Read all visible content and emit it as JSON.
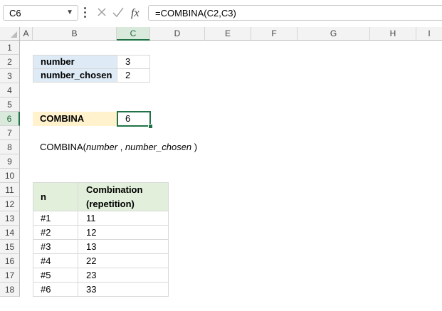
{
  "formula_bar": {
    "name_box": "C6",
    "formula": "=COMBINA(C2,C3)"
  },
  "columns": [
    "A",
    "B",
    "C",
    "D",
    "E",
    "F",
    "G",
    "H",
    "I"
  ],
  "rows": [
    "1",
    "2",
    "3",
    "4",
    "5",
    "6",
    "7",
    "8",
    "9",
    "10",
    "11",
    "12",
    "13",
    "14",
    "15",
    "16",
    "17",
    "18"
  ],
  "inputs": {
    "number_label": "number",
    "number_value": "3",
    "number_chosen_label": "number_chosen",
    "number_chosen_value": "2"
  },
  "result": {
    "label": "COMBINA",
    "value": "6"
  },
  "syntax": {
    "fn": "COMBINA(",
    "arg1": "number",
    "sep": " , ",
    "arg2": "number_chosen",
    "close": " )"
  },
  "table": {
    "header_n": "n",
    "header_combo_line1": "Combination",
    "header_combo_line2": "(repetition)",
    "rows": [
      {
        "n": "#1",
        "combo": "11"
      },
      {
        "n": "#2",
        "combo": "12"
      },
      {
        "n": "#3",
        "combo": "13"
      },
      {
        "n": "#4",
        "combo": "22"
      },
      {
        "n": "#5",
        "combo": "23"
      },
      {
        "n": "#6",
        "combo": "33"
      }
    ]
  },
  "colors": {
    "accent": "#217346",
    "input_fill": "#deebf6",
    "result_fill": "#fff2cc",
    "table_header_fill": "#e2efda"
  },
  "icons": [
    "chevron-down-icon",
    "more-options-icon",
    "cancel-icon",
    "enter-icon",
    "insert-function-icon"
  ]
}
